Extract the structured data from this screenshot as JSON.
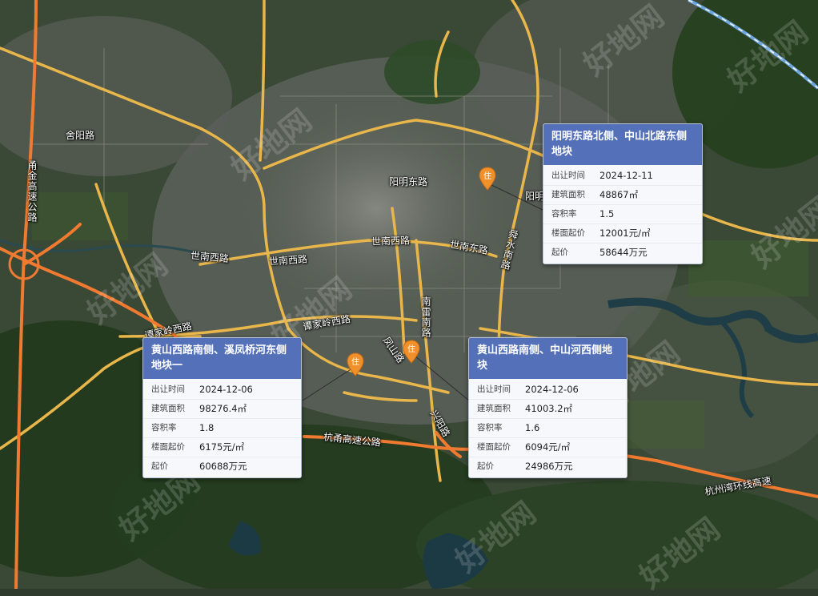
{
  "map": {
    "road_labels": {
      "sishui_road": "舍阳路",
      "expressway_west": "甬金高速公路",
      "yangming_east": "阳明东路",
      "shinan_west_1": "世南西路",
      "shinan_west_2": "世南西路",
      "shinan_west_3": "世南西路",
      "shinan_east": "世南东路",
      "tanjialing_west_1": "谭家岭西路",
      "tanjialing_west_2": "谭家岭西路",
      "nanlei_road": "南雷南路",
      "fengshan_road": "凤山路",
      "xingyang": "兴阳路",
      "hangyong_express": "杭甬高速公路",
      "hangzhou_ningbo": "杭州湾环线高速",
      "yangming_road": "阳明",
      "xiaqi_road": "舜水南路"
    },
    "watermark_text": "好地网"
  },
  "popups": [
    {
      "title": "阳明东路北侧、中山北路东侧地块",
      "rows": [
        {
          "label": "出让时间",
          "value": "2024-12-11"
        },
        {
          "label": "建筑面积",
          "value": "48867㎡"
        },
        {
          "label": "容积率",
          "value": "1.5"
        },
        {
          "label": "楼面起价",
          "value": "12001元/㎡"
        },
        {
          "label": "起价",
          "value": "58644万元"
        }
      ]
    },
    {
      "title": "黄山西路南侧、溪凤桥河东侧地块一",
      "rows": [
        {
          "label": "出让时间",
          "value": "2024-12-06"
        },
        {
          "label": "建筑面积",
          "value": "98276.4㎡"
        },
        {
          "label": "容积率",
          "value": "1.8"
        },
        {
          "label": "楼面起价",
          "value": "6175元/㎡"
        },
        {
          "label": "起价",
          "value": "60688万元"
        }
      ]
    },
    {
      "title": "黄山西路南侧、中山河西侧地块",
      "rows": [
        {
          "label": "出让时间",
          "value": "2024-12-06"
        },
        {
          "label": "建筑面积",
          "value": "41003.2㎡"
        },
        {
          "label": "容积率",
          "value": "1.6"
        },
        {
          "label": "楼面起价",
          "value": "6094元/㎡"
        },
        {
          "label": "起价",
          "value": "24986万元"
        }
      ]
    }
  ],
  "markers": [
    {
      "icon": "residential-pin-icon",
      "glyph": "住"
    },
    {
      "icon": "residential-pin-icon",
      "glyph": "住"
    },
    {
      "icon": "residential-pin-icon",
      "glyph": "住"
    }
  ],
  "colors": {
    "card_header": "#5470b8",
    "road_main": "#e8b64a",
    "road_highway": "#f07a30",
    "marker": "#f0902a",
    "water": "#1f3a40"
  }
}
